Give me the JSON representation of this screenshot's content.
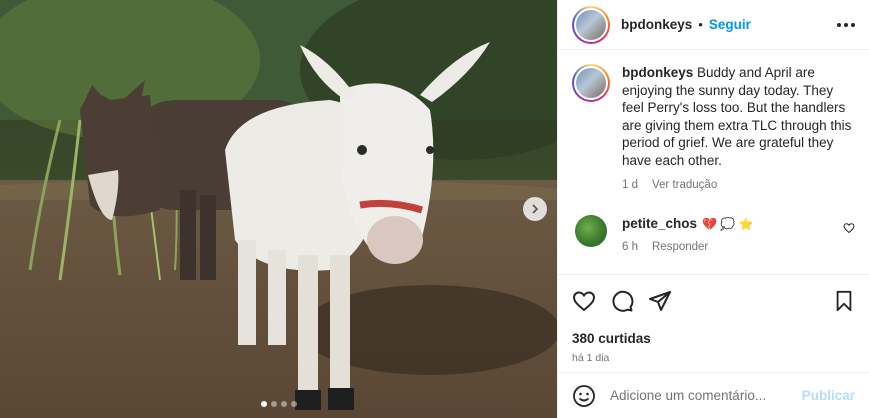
{
  "header": {
    "username": "bpdonkeys",
    "separator": "•",
    "follow_label": "Seguir"
  },
  "caption": {
    "username": "bpdonkeys",
    "text": "Buddy and April are enjoying the sunny day today. They feel Perry's loss too. But the handlers are giving them extra TLC through this period of grief. We are grateful they have each other.",
    "time": "1 d",
    "translate_label": "Ver tradução"
  },
  "comment": {
    "username": "petite_chos",
    "emojis": "💔 💭 ⭐",
    "time": "6 h",
    "reply_label": "Responder"
  },
  "stats": {
    "likes": "380 curtidas",
    "posted": "há 1 dia"
  },
  "add_comment": {
    "placeholder": "Adicione um comentário...",
    "publish_label": "Publicar"
  },
  "carousel": {
    "slide_count": 4,
    "active_slide": 1
  },
  "icons": {
    "more": "more-icon",
    "next": "chevron-right-icon",
    "like": "heart-icon",
    "comment": "comment-icon",
    "share": "send-icon",
    "save": "bookmark-icon",
    "emoji": "smiley-icon"
  },
  "colors": {
    "accent": "#0095f6",
    "publish_disabled": "#b2dffc",
    "muted_text": "#737373"
  }
}
